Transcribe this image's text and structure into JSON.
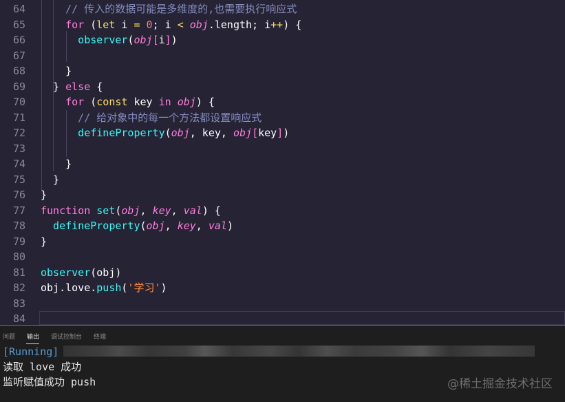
{
  "editor": {
    "lines": [
      {
        "n": "64",
        "parts": [
          [
            "tk-comment",
            "    // 传入的数据可能是多维度的,也需要执行响应式"
          ]
        ]
      },
      {
        "n": "65",
        "parts": [
          [
            "tk-kw2",
            "    for"
          ],
          [
            "tk-pl",
            " ("
          ],
          [
            "tk-kw",
            "let"
          ],
          [
            "tk-pl",
            " i "
          ],
          [
            "tk-op",
            "="
          ],
          [
            "tk-pl",
            " "
          ],
          [
            "tk-num",
            "0"
          ],
          [
            "tk-pl",
            "; i "
          ],
          [
            "tk-op",
            "<"
          ],
          [
            "tk-pl",
            " "
          ],
          [
            "tk-var",
            "obj"
          ],
          [
            "tk-pl",
            ".length; i"
          ],
          [
            "tk-op",
            "++"
          ],
          [
            "tk-pl",
            ") {"
          ]
        ]
      },
      {
        "n": "66",
        "parts": [
          [
            "tk-fn",
            "      observer"
          ],
          [
            "tk-pl",
            "("
          ],
          [
            "tk-var",
            "obj"
          ],
          [
            "tk-key",
            "["
          ],
          [
            "tk-pl",
            "i"
          ],
          [
            "tk-key",
            "]"
          ],
          [
            "tk-pl",
            ")"
          ]
        ]
      },
      {
        "n": "67",
        "parts": [
          [
            "tk-pl",
            ""
          ]
        ]
      },
      {
        "n": "68",
        "parts": [
          [
            "tk-pl",
            "    }"
          ]
        ]
      },
      {
        "n": "69",
        "parts": [
          [
            "tk-pl",
            "  } "
          ],
          [
            "tk-kw2",
            "else"
          ],
          [
            "tk-pl",
            " {"
          ]
        ]
      },
      {
        "n": "70",
        "parts": [
          [
            "tk-kw2",
            "    for"
          ],
          [
            "tk-pl",
            " ("
          ],
          [
            "tk-kw",
            "const"
          ],
          [
            "tk-pl",
            " key "
          ],
          [
            "tk-kw2",
            "in"
          ],
          [
            "tk-pl",
            " "
          ],
          [
            "tk-var",
            "obj"
          ],
          [
            "tk-pl",
            ") {"
          ]
        ]
      },
      {
        "n": "71",
        "parts": [
          [
            "tk-comment",
            "      // 给对象中的每一个方法都设置响应式"
          ]
        ]
      },
      {
        "n": "72",
        "parts": [
          [
            "tk-fn",
            "      defineProperty"
          ],
          [
            "tk-pl",
            "("
          ],
          [
            "tk-var",
            "obj"
          ],
          [
            "tk-pl",
            ", key, "
          ],
          [
            "tk-var",
            "obj"
          ],
          [
            "tk-key",
            "["
          ],
          [
            "tk-pl",
            "key"
          ],
          [
            "tk-key",
            "]"
          ],
          [
            "tk-pl",
            ")"
          ]
        ]
      },
      {
        "n": "73",
        "parts": [
          [
            "tk-pl",
            ""
          ]
        ]
      },
      {
        "n": "74",
        "parts": [
          [
            "tk-pl",
            "    }"
          ]
        ]
      },
      {
        "n": "75",
        "parts": [
          [
            "tk-pl",
            "  }"
          ]
        ]
      },
      {
        "n": "76",
        "parts": [
          [
            "tk-pl",
            "}"
          ]
        ]
      },
      {
        "n": "77",
        "parts": [
          [
            "tk-kw2",
            "function"
          ],
          [
            "tk-pl",
            " "
          ],
          [
            "tk-fn",
            "set"
          ],
          [
            "tk-pl",
            "("
          ],
          [
            "tk-var",
            "obj"
          ],
          [
            "tk-pl",
            ", "
          ],
          [
            "tk-var",
            "key"
          ],
          [
            "tk-pl",
            ", "
          ],
          [
            "tk-var",
            "val"
          ],
          [
            "tk-pl",
            ") {"
          ]
        ]
      },
      {
        "n": "78",
        "parts": [
          [
            "tk-fn",
            "  defineProperty"
          ],
          [
            "tk-pl",
            "("
          ],
          [
            "tk-var",
            "obj"
          ],
          [
            "tk-pl",
            ", "
          ],
          [
            "tk-var",
            "key"
          ],
          [
            "tk-pl",
            ", "
          ],
          [
            "tk-var",
            "val"
          ],
          [
            "tk-pl",
            ")"
          ]
        ]
      },
      {
        "n": "79",
        "parts": [
          [
            "tk-pl",
            "}"
          ]
        ]
      },
      {
        "n": "80",
        "parts": [
          [
            "tk-pl",
            ""
          ]
        ]
      },
      {
        "n": "81",
        "parts": [
          [
            "tk-fn",
            "observer"
          ],
          [
            "tk-pl",
            "(obj)"
          ]
        ]
      },
      {
        "n": "82",
        "parts": [
          [
            "tk-pl",
            "obj.love."
          ],
          [
            "tk-fn",
            "push"
          ],
          [
            "tk-pl",
            "("
          ],
          [
            "tk-str",
            "'学习'"
          ],
          [
            "tk-pl",
            ")"
          ]
        ]
      },
      {
        "n": "83",
        "parts": [
          [
            "tk-pl",
            ""
          ]
        ]
      },
      {
        "n": "84",
        "parts": [
          [
            "tk-pl",
            ""
          ]
        ]
      }
    ]
  },
  "panel": {
    "tabs": [
      "问题",
      "输出",
      "调试控制台",
      "终端"
    ],
    "active_tab": "输出",
    "output": {
      "running": "[Running]",
      "line1": "读取 love 成功",
      "line2": "监听赋值成功 push"
    }
  },
  "watermark": "@稀土掘金技术社区",
  "colors": {
    "background": "#262335",
    "comment": "#848bbd",
    "keyword": "#fede5d",
    "keyword2": "#ff7edb",
    "function": "#36f9f6",
    "number": "#f97e72",
    "string": "#ff8b39",
    "running": "#569cd6"
  }
}
